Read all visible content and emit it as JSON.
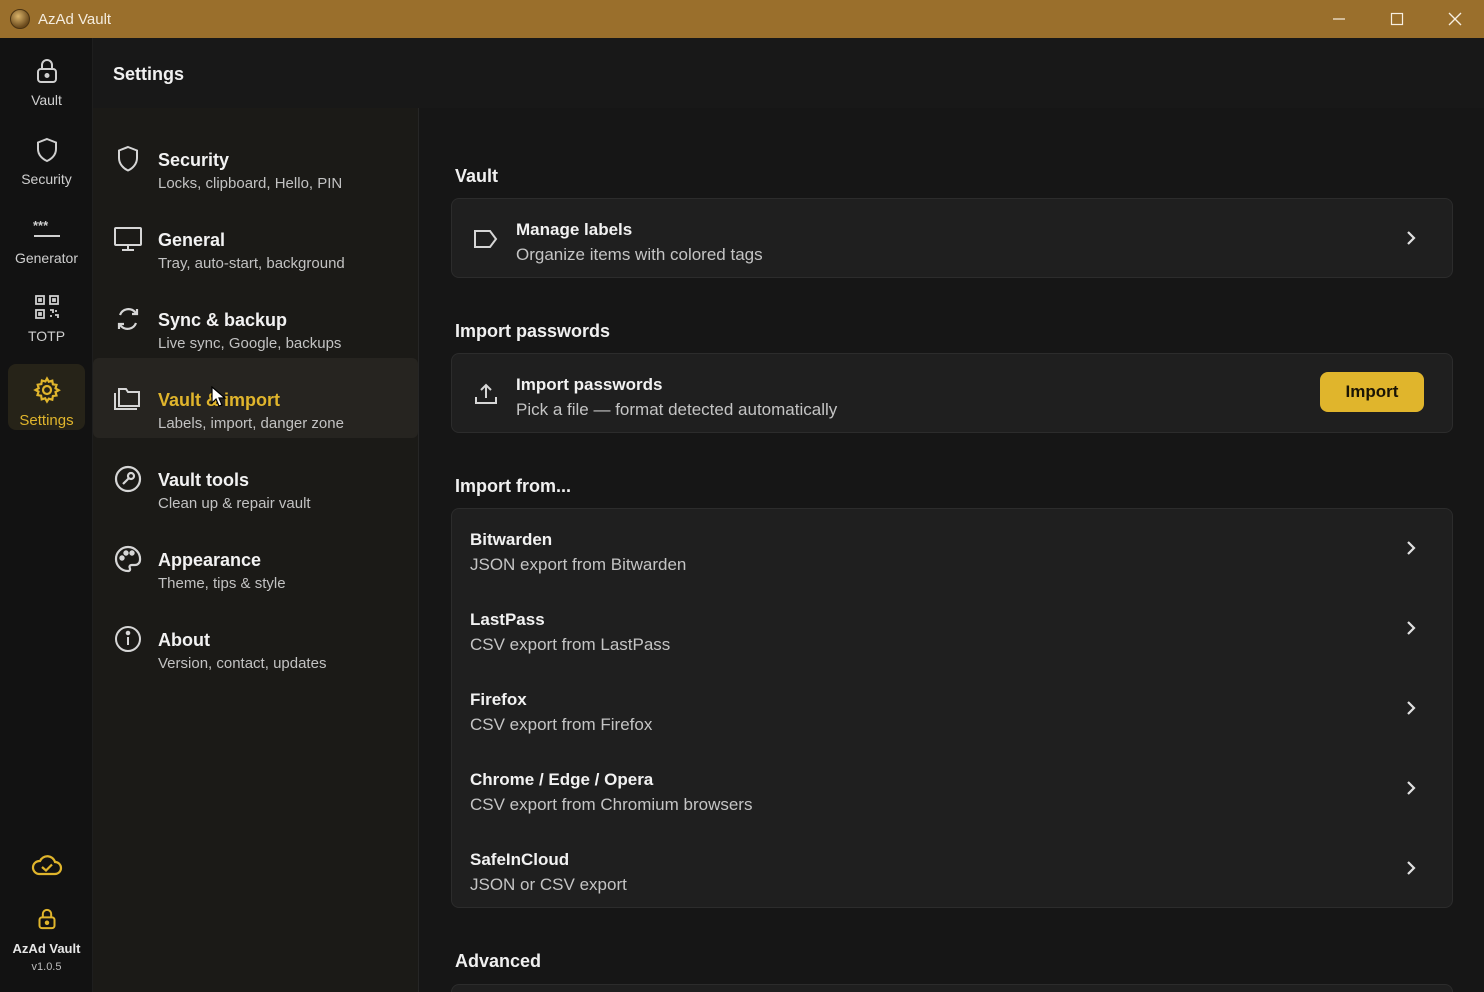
{
  "window": {
    "title": "AzAd Vault"
  },
  "rail": {
    "items": [
      {
        "label": "Vault",
        "icon": "lock-icon"
      },
      {
        "label": "Security",
        "icon": "shield-icon"
      },
      {
        "label": "Generator",
        "icon": "password-dots-icon"
      },
      {
        "label": "TOTP",
        "icon": "qr-code-icon"
      },
      {
        "label": "Settings",
        "icon": "gear-icon",
        "active": true
      }
    ],
    "footer": {
      "name": "AzAd Vault",
      "version": "v1.0.5"
    }
  },
  "header": {
    "title": "Settings"
  },
  "categories": [
    {
      "title": "Security",
      "subtitle": "Locks, clipboard, Hello, PIN",
      "icon": "shield-icon"
    },
    {
      "title": "General",
      "subtitle": "Tray, auto-start, background",
      "icon": "monitor-icon"
    },
    {
      "title": "Sync & backup",
      "subtitle": "Live sync, Google, backups",
      "icon": "sync-icon"
    },
    {
      "title": "Vault & import",
      "subtitle": "Labels, import, danger zone",
      "icon": "folders-icon",
      "active": true
    },
    {
      "title": "Vault tools",
      "subtitle": "Clean up & repair vault",
      "icon": "wrench-icon"
    },
    {
      "title": "Appearance",
      "subtitle": "Theme, tips & style",
      "icon": "palette-icon"
    },
    {
      "title": "About",
      "subtitle": "Version, contact, updates",
      "icon": "info-icon"
    }
  ],
  "content": {
    "vault": {
      "heading": "Vault",
      "manage_labels": {
        "title": "Manage labels",
        "subtitle": "Organize items with colored tags"
      }
    },
    "import_passwords": {
      "heading": "Import passwords",
      "title": "Import passwords",
      "subtitle": "Pick a file — format detected automatically",
      "button": "Import"
    },
    "import_from": {
      "heading": "Import from...",
      "sources": [
        {
          "title": "Bitwarden",
          "subtitle": "JSON export from Bitwarden"
        },
        {
          "title": "LastPass",
          "subtitle": "CSV export from LastPass"
        },
        {
          "title": "Firefox",
          "subtitle": "CSV export from Firefox"
        },
        {
          "title": "Chrome / Edge / Opera",
          "subtitle": "CSV export from Chromium browsers"
        },
        {
          "title": "SafeInCloud",
          "subtitle": "JSON or CSV export"
        }
      ]
    },
    "advanced": {
      "heading": "Advanced"
    }
  },
  "colors": {
    "accent": "#e0b52c",
    "titlebar": "#9a6f2c",
    "background": "#161616"
  }
}
